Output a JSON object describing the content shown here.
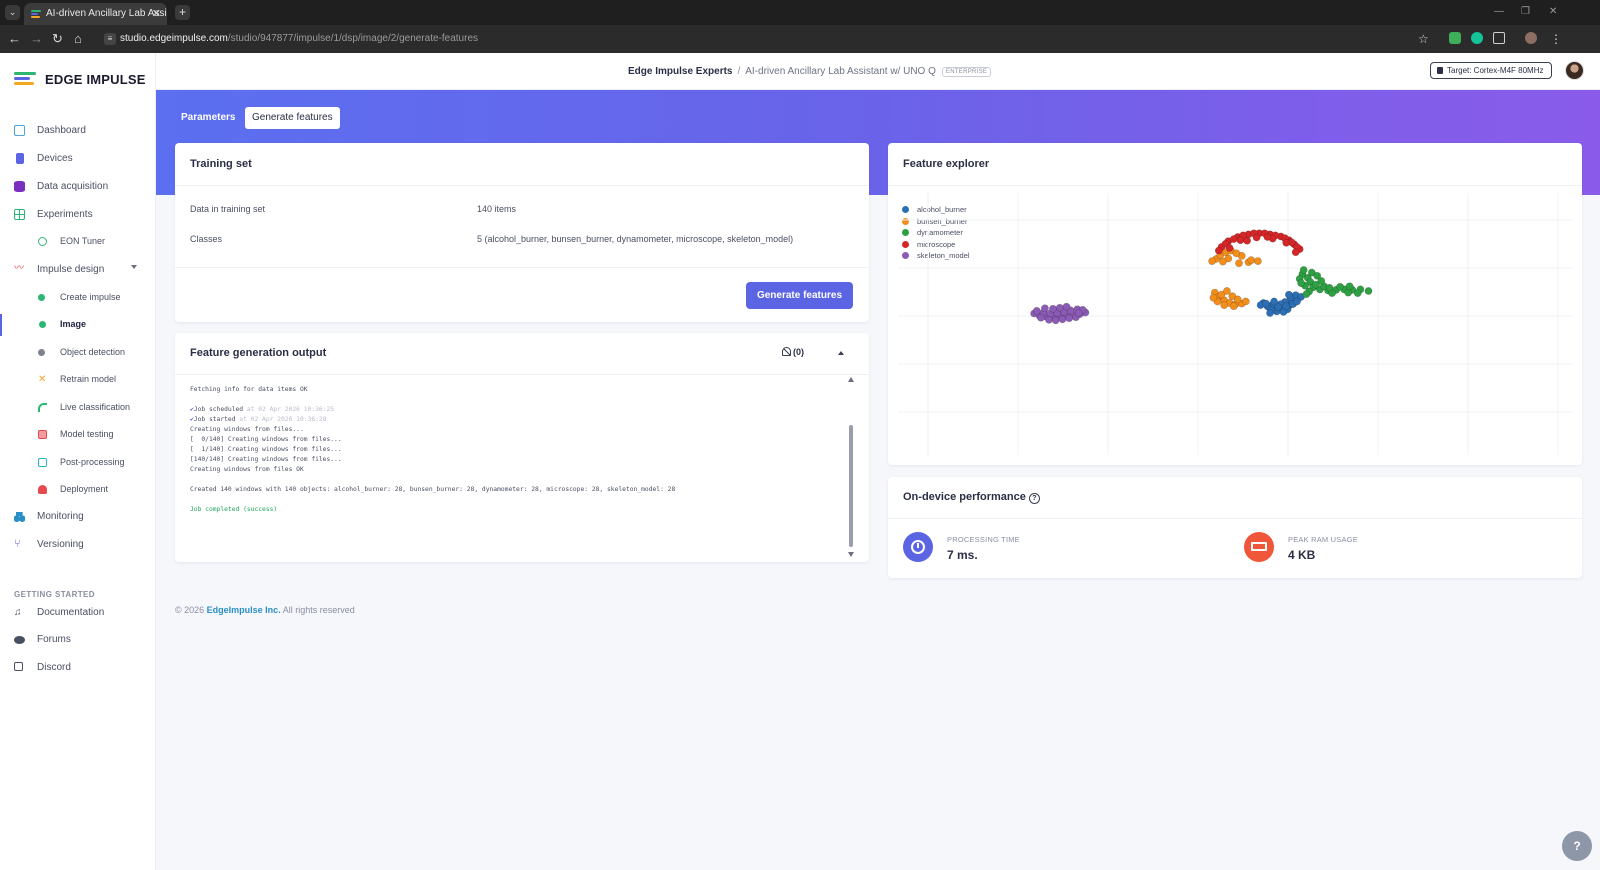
{
  "browser": {
    "tab_title": "AI-driven Ancillary Lab Assistan",
    "tab_close": "✕",
    "new_tab": "+",
    "url_host": "studio.edgeimpulse.com",
    "url_path": "/studio/947877/impulse/1/dsp/image/2/generate-features"
  },
  "sidebar": {
    "logo_text": "EDGE IMPULSE",
    "items": [
      {
        "label": "Dashboard",
        "icon": "monitor-icon",
        "color": "#4aa3df"
      },
      {
        "label": "Devices",
        "icon": "device-icon",
        "color": "#5b64e3"
      },
      {
        "label": "Data acquisition",
        "icon": "database-icon",
        "color": "#7a2fbf"
      },
      {
        "label": "Experiments",
        "icon": "table-icon",
        "color": "#2bb673"
      },
      {
        "label": "EON Tuner",
        "icon": "tuner-icon",
        "color": "#2bb673"
      },
      {
        "label": "Impulse design",
        "icon": "pulse-icon",
        "color": "#e5484d"
      },
      {
        "label": "Create impulse",
        "icon": "dot-icon",
        "color": "#2bb673"
      },
      {
        "label": "Image",
        "icon": "dot-icon",
        "color": "#2bb673"
      },
      {
        "label": "Object detection",
        "icon": "dot-icon",
        "color": "#7d8190"
      },
      {
        "label": "Retrain model",
        "icon": "shuffle-icon",
        "color": "#f5a623"
      },
      {
        "label": "Live classification",
        "icon": "live-icon",
        "color": "#2bb673"
      },
      {
        "label": "Model testing",
        "icon": "test-icon",
        "color": "#e5484d"
      },
      {
        "label": "Post-processing",
        "icon": "post-icon",
        "color": "#2ab3c9"
      },
      {
        "label": "Deployment",
        "icon": "rocket-icon",
        "color": "#e5484d"
      },
      {
        "label": "Monitoring",
        "icon": "binoculars-icon",
        "color": "#2a8fc7"
      },
      {
        "label": "Versioning",
        "icon": "branch-icon",
        "color": "#5b64e3"
      }
    ],
    "getting_started_heading": "GETTING STARTED",
    "getting_started": [
      {
        "label": "Documentation",
        "icon": "book-icon"
      },
      {
        "label": "Forums",
        "icon": "chat-icon"
      },
      {
        "label": "Discord",
        "icon": "discord-icon"
      }
    ]
  },
  "header": {
    "org": "Edge Impulse Experts",
    "separator": "/",
    "project": "AI-driven Ancillary Lab Assistant w/ UNO Q",
    "badge": "ENTERPRISE",
    "target": "Target: Cortex-M4F 80MHz"
  },
  "tabs": {
    "parameters": "Parameters",
    "generate_features": "Generate features"
  },
  "training_set": {
    "title": "Training set",
    "data_label": "Data in training set",
    "data_value": "140 items",
    "classes_label": "Classes",
    "classes_value": "5 (alcohol_burner, bunsen_burner, dynamometer, microscope, skeleton_model)",
    "button": "Generate features"
  },
  "output": {
    "title": "Feature generation output",
    "notif_count": "(0)",
    "lines": [
      {
        "text": "Fetching info for data items OK",
        "kind": "plain"
      },
      {
        "text": "",
        "kind": "plain"
      },
      {
        "text": "Job scheduled",
        "ts": " at 02 Apr 2026 10:36:25",
        "kind": "check"
      },
      {
        "text": "Job started",
        "ts": " at 02 Apr 2026 10:36:28",
        "kind": "check"
      },
      {
        "text": "Creating windows from files...",
        "kind": "plain"
      },
      {
        "text": "[  0/140] Creating windows from files...",
        "kind": "plain"
      },
      {
        "text": "[  1/140] Creating windows from files...",
        "kind": "plain"
      },
      {
        "text": "[140/140] Creating windows from files...",
        "kind": "plain"
      },
      {
        "text": "Creating windows from files OK",
        "kind": "plain"
      },
      {
        "text": "",
        "kind": "plain"
      },
      {
        "text": "Created 140 windows with 140 objects: alcohol_burner: 28, bunsen_burner: 28, dynamometer: 28, microscope: 28, skeleton_model: 28",
        "kind": "plain"
      },
      {
        "text": "",
        "kind": "plain"
      },
      {
        "text": "Job completed (success)",
        "kind": "ok"
      }
    ]
  },
  "explorer": {
    "title": "Feature explorer",
    "legend": [
      {
        "label": "alcohol_burner",
        "color": "#2c6fb5"
      },
      {
        "label": "bunsen_burner",
        "color": "#f28e1c"
      },
      {
        "label": "dynamometer",
        "color": "#2ea043"
      },
      {
        "label": "microscope",
        "color": "#d62728"
      },
      {
        "label": "skeleton_model",
        "color": "#8c5bb5"
      }
    ]
  },
  "chart_data": {
    "type": "scatter",
    "title": "",
    "xlabel": "",
    "ylabel": "",
    "grid": true,
    "legend_position": "top-left",
    "xlim": [
      0,
      100
    ],
    "ylim": [
      0,
      100
    ],
    "series": [
      {
        "name": "alcohol_burner",
        "color": "#2c6fb5",
        "points": [
          [
            54.2,
            58.0
          ],
          [
            55.0,
            56.5
          ],
          [
            56.0,
            55.8
          ],
          [
            57.0,
            56.2
          ],
          [
            58.0,
            57.0
          ],
          [
            58.8,
            58.2
          ],
          [
            59.4,
            59.8
          ],
          [
            55.6,
            57.4
          ],
          [
            57.4,
            58.4
          ],
          [
            56.2,
            54.8
          ],
          [
            58.4,
            59.2
          ],
          [
            59.0,
            61.0
          ],
          [
            54.8,
            56.8
          ],
          [
            57.8,
            55.6
          ],
          [
            55.4,
            55.2
          ],
          [
            56.8,
            57.6
          ],
          [
            58.6,
            57.6
          ],
          [
            59.8,
            60.4
          ],
          [
            53.8,
            57.2
          ],
          [
            57.2,
            54.6
          ],
          [
            55.8,
            58.6
          ],
          [
            58.2,
            60.2
          ],
          [
            56.4,
            56.4
          ],
          [
            54.6,
            57.8
          ],
          [
            59.2,
            58.6
          ],
          [
            57.6,
            56.8
          ],
          [
            55.2,
            54.2
          ],
          [
            58.0,
            61.2
          ]
        ]
      },
      {
        "name": "bunsen_burner",
        "color": "#f28e1c",
        "points": [
          [
            47.2,
            74.8
          ],
          [
            47.8,
            76.2
          ],
          [
            48.6,
            77.4
          ],
          [
            49.4,
            78.0
          ],
          [
            50.6,
            73.2
          ],
          [
            52.0,
            73.6
          ],
          [
            53.4,
            74.0
          ],
          [
            51.0,
            76.0
          ],
          [
            49.0,
            75.0
          ],
          [
            48.2,
            73.8
          ],
          [
            50.2,
            77.0
          ],
          [
            47.0,
            62.0
          ],
          [
            47.6,
            60.4
          ],
          [
            48.4,
            59.0
          ],
          [
            49.2,
            58.0
          ],
          [
            50.0,
            57.4
          ],
          [
            51.0,
            57.8
          ],
          [
            48.0,
            61.2
          ],
          [
            49.6,
            60.6
          ],
          [
            50.4,
            59.4
          ],
          [
            47.4,
            58.6
          ],
          [
            48.8,
            62.6
          ],
          [
            46.8,
            60.0
          ],
          [
            49.8,
            56.8
          ],
          [
            51.6,
            58.6
          ],
          [
            48.4,
            57.2
          ],
          [
            52.4,
            74.4
          ],
          [
            46.6,
            74.0
          ]
        ]
      },
      {
        "name": "dynamometer",
        "color": "#2ea043",
        "points": [
          [
            60.0,
            69.0
          ],
          [
            60.8,
            67.6
          ],
          [
            61.2,
            66.0
          ],
          [
            60.4,
            64.6
          ],
          [
            61.6,
            64.0
          ],
          [
            62.6,
            63.2
          ],
          [
            63.8,
            62.8
          ],
          [
            65.0,
            63.0
          ],
          [
            66.2,
            63.2
          ],
          [
            67.4,
            63.0
          ],
          [
            68.6,
            63.2
          ],
          [
            69.8,
            62.6
          ],
          [
            60.2,
            70.6
          ],
          [
            61.4,
            69.6
          ],
          [
            62.2,
            68.4
          ],
          [
            59.6,
            67.2
          ],
          [
            61.0,
            62.4
          ],
          [
            62.0,
            65.0
          ],
          [
            63.2,
            64.4
          ],
          [
            64.4,
            61.8
          ],
          [
            65.6,
            64.2
          ],
          [
            66.8,
            62.0
          ],
          [
            59.8,
            65.6
          ],
          [
            60.6,
            61.4
          ],
          [
            62.8,
            66.4
          ],
          [
            64.0,
            63.8
          ],
          [
            67.0,
            64.4
          ],
          [
            68.2,
            61.8
          ]
        ]
      },
      {
        "name": "microscope",
        "color": "#d62728",
        "points": [
          [
            48.0,
            79.4
          ],
          [
            49.0,
            81.6
          ],
          [
            50.4,
            83.2
          ],
          [
            52.0,
            84.2
          ],
          [
            53.6,
            84.6
          ],
          [
            55.2,
            84.2
          ],
          [
            56.8,
            83.4
          ],
          [
            58.0,
            82.0
          ],
          [
            58.8,
            80.4
          ],
          [
            59.6,
            78.6
          ],
          [
            48.6,
            80.6
          ],
          [
            49.8,
            82.4
          ],
          [
            51.2,
            83.8
          ],
          [
            52.8,
            84.6
          ],
          [
            54.4,
            84.6
          ],
          [
            56.0,
            83.8
          ],
          [
            57.4,
            82.8
          ],
          [
            58.4,
            81.2
          ],
          [
            59.2,
            79.4
          ],
          [
            47.6,
            78.0
          ],
          [
            50.8,
            82.0
          ],
          [
            53.2,
            83.0
          ],
          [
            55.6,
            82.6
          ],
          [
            57.6,
            81.0
          ],
          [
            59.0,
            77.4
          ],
          [
            49.2,
            79.0
          ],
          [
            51.8,
            81.8
          ],
          [
            54.8,
            83.2
          ]
        ]
      },
      {
        "name": "skeleton_model",
        "color": "#8c5bb5",
        "points": [
          [
            20.2,
            54.0
          ],
          [
            21.0,
            53.2
          ],
          [
            22.0,
            52.8
          ],
          [
            23.0,
            52.6
          ],
          [
            24.0,
            52.8
          ],
          [
            25.0,
            53.0
          ],
          [
            26.0,
            53.4
          ],
          [
            27.0,
            53.8
          ],
          [
            27.8,
            54.4
          ],
          [
            20.6,
            55.0
          ],
          [
            21.6,
            54.4
          ],
          [
            22.6,
            54.0
          ],
          [
            23.6,
            54.2
          ],
          [
            24.6,
            54.6
          ],
          [
            25.6,
            55.2
          ],
          [
            26.6,
            55.6
          ],
          [
            27.4,
            55.4
          ],
          [
            21.2,
            52.4
          ],
          [
            22.4,
            51.6
          ],
          [
            23.4,
            51.4
          ],
          [
            24.4,
            51.8
          ],
          [
            25.4,
            52.2
          ],
          [
            26.4,
            52.6
          ],
          [
            23.0,
            55.8
          ],
          [
            24.0,
            56.2
          ],
          [
            25.0,
            56.6
          ],
          [
            21.8,
            56.0
          ],
          [
            26.8,
            54.2
          ]
        ]
      }
    ]
  },
  "performance": {
    "title": "On-device performance",
    "processing_label": "PROCESSING TIME",
    "processing_value": "7 ms.",
    "ram_label": "PEAK RAM USAGE",
    "ram_value": "4 KB"
  },
  "footer": {
    "copyright": "© 2026",
    "company": "EdgeImpulse Inc.",
    "rights": "All rights reserved"
  }
}
